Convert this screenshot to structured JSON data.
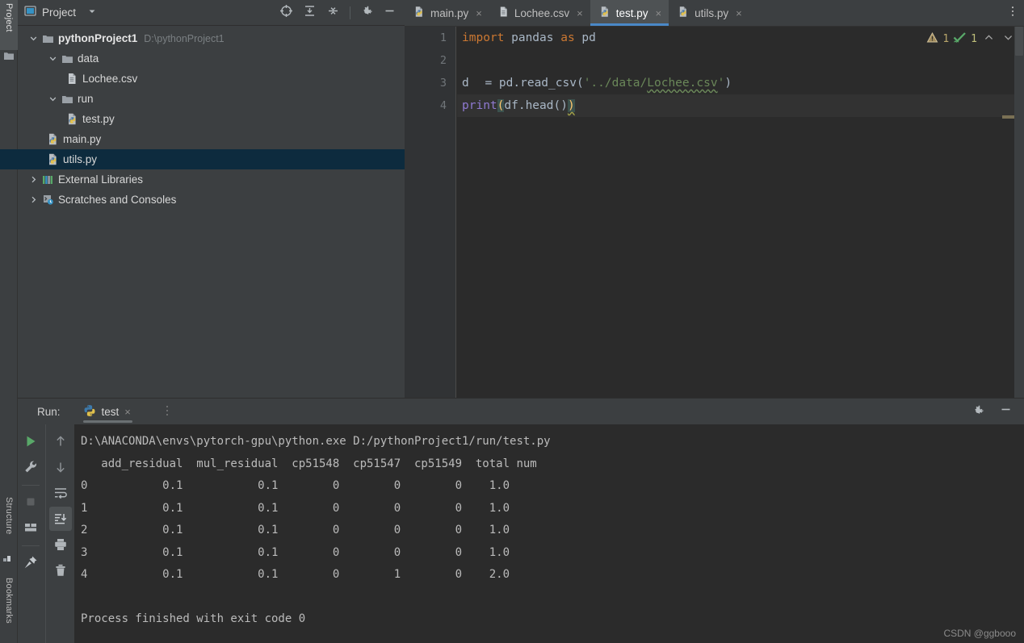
{
  "left_tool_strip": {
    "tabs": [
      {
        "label": "Project",
        "icon": "folder-icon",
        "active": true
      },
      {
        "label": "Structure",
        "icon": "structure-icon",
        "active": false
      },
      {
        "label": "Bookmarks",
        "icon": "bookmark-icon",
        "active": false
      }
    ]
  },
  "project_panel": {
    "title": "Project",
    "title_icon": "project-view-icon",
    "dropdown_icon": "chevron-down-icon",
    "toolbar": [
      {
        "name": "locate-icon",
        "tooltip": "Select Opened File"
      },
      {
        "name": "expand-all-icon",
        "tooltip": "Expand All"
      },
      {
        "name": "collapse-all-icon",
        "tooltip": "Collapse All"
      },
      {
        "name": "gear-icon",
        "tooltip": "Options"
      },
      {
        "name": "hide-icon",
        "tooltip": "Hide"
      }
    ],
    "tree": [
      {
        "label": "pythonProject1",
        "path": "D:\\pythonProject1",
        "icon": "folder-icon",
        "arrow": "expanded",
        "indent": 1,
        "bold": true,
        "selected": false
      },
      {
        "label": "data",
        "path": "",
        "icon": "folder-icon",
        "arrow": "expanded",
        "indent": 2,
        "bold": false,
        "selected": false
      },
      {
        "label": "Lochee.csv",
        "path": "",
        "icon": "csv-file-icon",
        "arrow": "none",
        "indent": 3,
        "bold": false,
        "selected": false
      },
      {
        "label": "run",
        "path": "",
        "icon": "folder-icon",
        "arrow": "expanded",
        "indent": 2,
        "bold": false,
        "selected": false
      },
      {
        "label": "test.py",
        "path": "",
        "icon": "python-file-icon",
        "arrow": "none",
        "indent": 3,
        "bold": false,
        "selected": false
      },
      {
        "label": "main.py",
        "path": "",
        "icon": "python-file-icon",
        "arrow": "none",
        "indent": 2,
        "bold": false,
        "selected": false
      },
      {
        "label": "utils.py",
        "path": "",
        "icon": "python-file-icon",
        "arrow": "none",
        "indent": 2,
        "bold": false,
        "selected": true
      },
      {
        "label": "External Libraries",
        "path": "",
        "icon": "libraries-icon",
        "arrow": "collapsed",
        "indent": 1,
        "bold": false,
        "selected": false
      },
      {
        "label": "Scratches and Consoles",
        "path": "",
        "icon": "scratches-icon",
        "arrow": "collapsed",
        "indent": 1,
        "bold": false,
        "selected": false
      }
    ]
  },
  "editor": {
    "tabs": [
      {
        "label": "main.py",
        "icon": "python-file-icon",
        "active": false,
        "close": "×"
      },
      {
        "label": "Lochee.csv",
        "icon": "csv-file-icon",
        "active": false,
        "close": "×"
      },
      {
        "label": "test.py",
        "icon": "python-file-icon",
        "active": true,
        "close": "×"
      },
      {
        "label": "utils.py",
        "icon": "python-file-icon",
        "active": false,
        "close": "×"
      }
    ],
    "overflow_icon": "more-vertical-icon",
    "line_numbers": [
      "1",
      "2",
      "3",
      "4"
    ],
    "code": {
      "l1_kw_import": "import",
      "l1_mod": " pandas ",
      "l1_kw_as": "as",
      "l1_alias": " pd",
      "l3_var": "d",
      "l3_assign": " = pd.read_csv(",
      "l3_str_open": "'../data/",
      "l3_str_file": "Lochee.csv",
      "l3_str_close": "'",
      "l3_paren_close": ")",
      "l4_fn": "print",
      "l4_open": "(",
      "l4_args": "df.head()",
      "l4_close": ")"
    },
    "inspection": {
      "warning_count": "1",
      "warning_icon": "warning-triangle-icon",
      "ok_count": "1",
      "ok_icon": "check-mark-icon",
      "prev_icon": "chevron-up-icon",
      "next_icon": "chevron-down-icon"
    },
    "intention_bulb_icon": "lightbulb-icon"
  },
  "run_panel": {
    "label": "Run:",
    "tab": {
      "label": "test",
      "icon": "python-icon",
      "close": "×"
    },
    "menu_icon": "more-vertical-icon",
    "right_tools": [
      {
        "name": "gear-icon",
        "tooltip": "Settings"
      },
      {
        "name": "hide-icon",
        "tooltip": "Hide"
      }
    ],
    "tool_column_1": [
      {
        "name": "run-button-icon",
        "tooltip": "Rerun"
      },
      {
        "name": "wrench-icon",
        "tooltip": "Modify Run Configuration"
      },
      {
        "name": "stop-button-icon",
        "tooltip": "Stop"
      },
      {
        "name": "layout-icon",
        "tooltip": "Layout Settings"
      },
      {
        "name": "pin-icon",
        "tooltip": "Pin Tab"
      }
    ],
    "tool_column_2": [
      {
        "name": "arrow-up-icon",
        "tooltip": "Up the Stack Trace",
        "selected": false
      },
      {
        "name": "arrow-down-icon",
        "tooltip": "Down the Stack Trace",
        "selected": false
      },
      {
        "name": "soft-wrap-icon",
        "tooltip": "Soft-Wrap",
        "selected": false
      },
      {
        "name": "scroll-to-end-icon",
        "tooltip": "Scroll to End",
        "selected": true
      },
      {
        "name": "print-icon",
        "tooltip": "Print",
        "selected": false
      },
      {
        "name": "trash-icon",
        "tooltip": "Clear All",
        "selected": false
      }
    ],
    "console": {
      "command_line": "D:\\ANACONDA\\envs\\pytorch-gpu\\python.exe D:/pythonProject1/run/test.py",
      "table_header": "   add_residual  mul_residual  cp51548  cp51547  cp51549  total num",
      "rows": [
        "0           0.1           0.1        0        0        0    1.0",
        "1           0.1           0.1        0        0        0    1.0",
        "2           0.1           0.1        0        0        0    1.0",
        "3           0.1           0.1        0        0        0    1.0",
        "4           0.1           0.1        0        1        0    2.0"
      ],
      "blank_line": "",
      "exit_line": "Process finished with exit code 0"
    }
  },
  "watermark": "CSDN @ggbooo",
  "colors": {
    "panel_bg": "#3c3f41",
    "editor_bg": "#2b2b2b",
    "gutter_bg": "#313335",
    "selection_bg": "#0d2b3e",
    "active_tab_bg": "#4e5254",
    "tab_underline": "#4a88c7",
    "keyword": "#cc7832",
    "string": "#6a8759",
    "identifier": "#a9b7c6",
    "builtin_fn": "#8f7ad1",
    "paren_highlight": "#ffc66d",
    "run_green": "#59a869"
  }
}
